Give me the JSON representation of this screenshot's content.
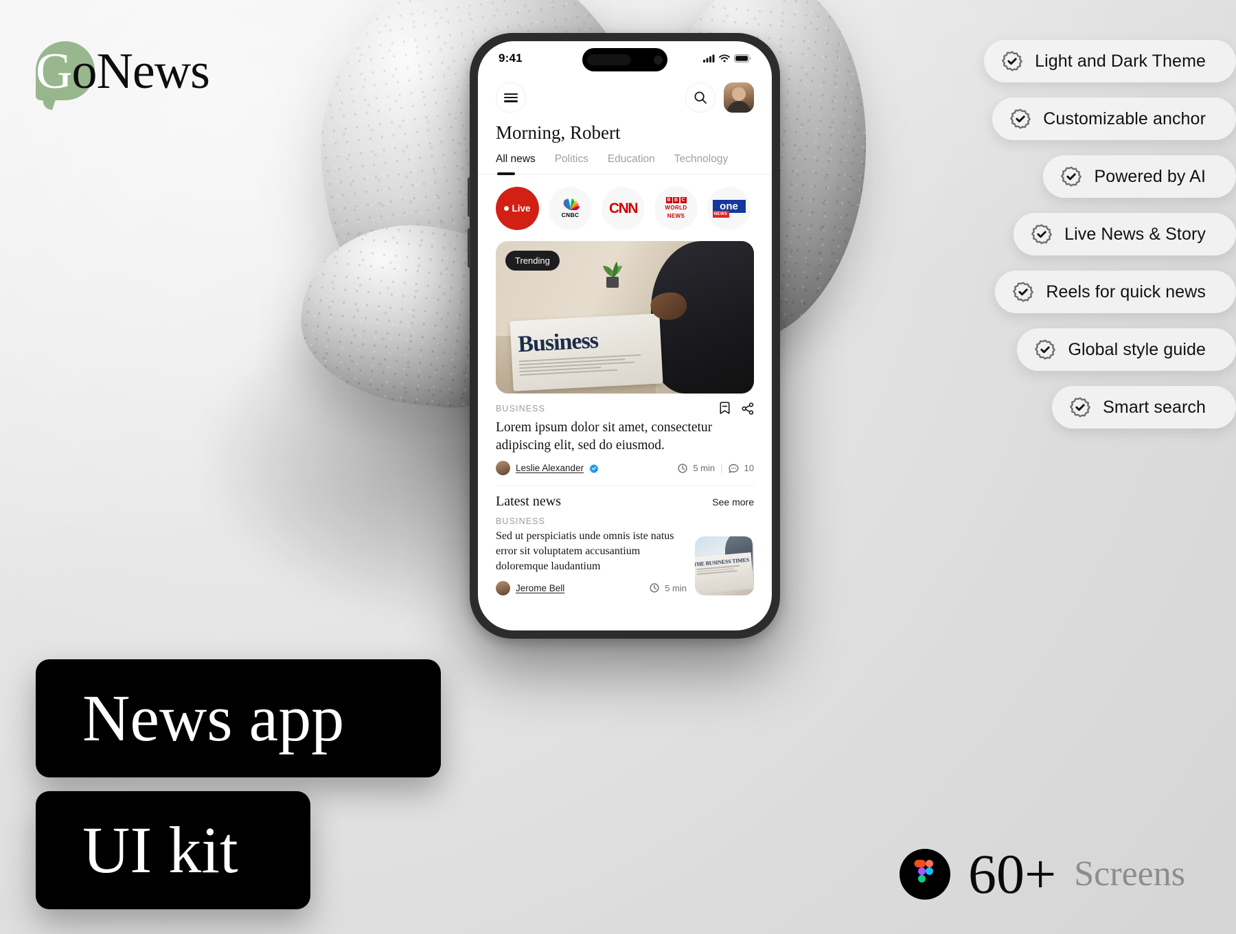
{
  "brand": {
    "name_part_1": "G",
    "name_part_2": "oNews",
    "full": "GoNews"
  },
  "features": [
    {
      "label": "Light and Dark Theme",
      "icon": "badge-check-icon"
    },
    {
      "label": "Customizable anchor",
      "icon": "badge-check-icon"
    },
    {
      "label": "Powered by AI",
      "icon": "badge-check-icon"
    },
    {
      "label": "Live News & Story",
      "icon": "badge-check-icon"
    },
    {
      "label": "Reels for quick news",
      "icon": "badge-check-icon"
    },
    {
      "label": "Global style guide",
      "icon": "badge-check-icon"
    },
    {
      "label": "Smart search",
      "icon": "badge-check-icon"
    }
  ],
  "title_cards": {
    "primary": "News app",
    "secondary": "UI kit"
  },
  "screens_badge": {
    "count": "60+",
    "word": "Screens",
    "icon": "figma-logo-icon"
  },
  "phone": {
    "status_bar": {
      "time": "9:41",
      "signal_icon": "cellular-signal-icon",
      "wifi_icon": "wifi-icon",
      "battery_icon": "battery-icon"
    },
    "app_bar": {
      "menu_icon": "hamburger-menu-icon",
      "search_icon": "search-icon",
      "avatar": "user-avatar"
    },
    "greeting": "Morning, Robert",
    "tabs": [
      {
        "label": "All news",
        "active": true
      },
      {
        "label": "Politics",
        "active": false
      },
      {
        "label": "Education",
        "active": false
      },
      {
        "label": "Technology",
        "active": false
      }
    ],
    "sources": [
      {
        "name": "Live",
        "type": "live"
      },
      {
        "name": "CNBC",
        "type": "logo"
      },
      {
        "name": "CNN",
        "type": "logo"
      },
      {
        "name": "BBC WORLD NEWS",
        "type": "logo",
        "line1": "WORLD",
        "line2": "NEWS",
        "blocks": [
          "B",
          "B",
          "C"
        ]
      },
      {
        "name": "one NEWS",
        "type": "logo",
        "main": "one",
        "tag": "NEWS"
      }
    ],
    "hero": {
      "badge": "Trending",
      "category": "BUSINESS",
      "headline": "Lorem ipsum dolor sit amet, consectetur adipiscing elit, sed do eiusmod.",
      "author": "Leslie Alexander",
      "verified": true,
      "read_time": "5 min",
      "comments": "10",
      "separator": "|",
      "bookmark_icon": "bookmark-minus-icon",
      "share_icon": "share-icon",
      "clock_icon": "clock-icon",
      "comment_icon": "comment-icon",
      "image_text": "Business"
    },
    "latest": {
      "title": "Latest news",
      "see_more": "See more",
      "items": [
        {
          "category": "BUSINESS",
          "headline": "Sed ut perspiciatis unde omnis iste natus error sit voluptatem accusantium doloremque laudantium",
          "author": "Jerome Bell",
          "read_time": "5 min",
          "thumb_text": "THE BUSINESS TIMES"
        }
      ]
    }
  },
  "colors": {
    "accent_green": "#8fb184",
    "live_red": "#d32015",
    "cnn_red": "#cc0000",
    "bbc_red": "#cc0000",
    "one_blue": "#14389b",
    "one_red": "#e1242a",
    "verified_blue": "#1d9bf0",
    "card_black": "#000000",
    "text_muted": "#9d9d9d"
  }
}
